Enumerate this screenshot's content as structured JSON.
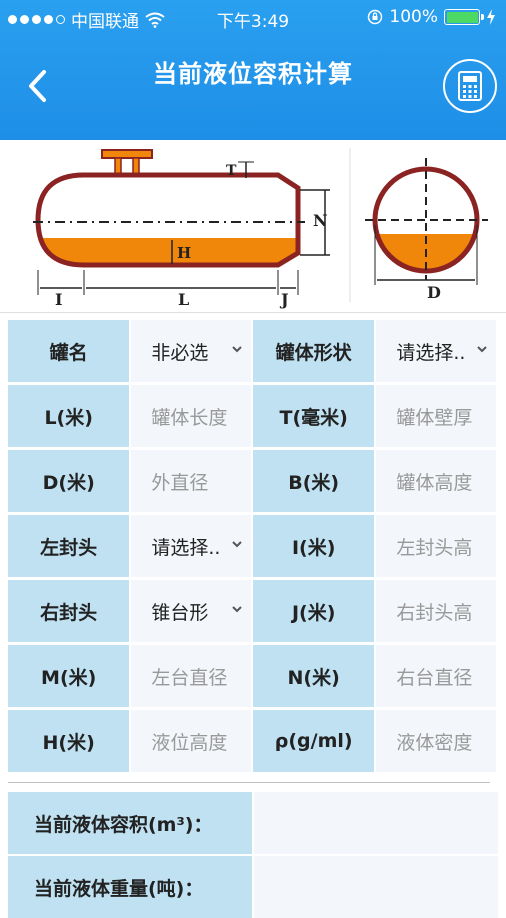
{
  "status": {
    "carrier": "中国联通",
    "time": "下午3:49",
    "battery": "100%"
  },
  "nav": {
    "title": "当前液位容积计算",
    "back_icon": "chevron-left-icon",
    "calc_icon": "calculator-icon"
  },
  "diagram": {
    "labels": {
      "T": "T",
      "N": "N",
      "H": "H",
      "I": "I",
      "L": "L",
      "J": "J",
      "D": "D"
    },
    "colors": {
      "tank": "#8b2323",
      "liquid": "#f0870a"
    }
  },
  "form": {
    "rows": [
      {
        "label1": "罐名",
        "value1": "非必选",
        "select1": true,
        "label2": "罐体形状",
        "value2": "请选择..",
        "select2": true
      },
      {
        "label1": "L(米)",
        "value1": "罐体长度",
        "label2": "T(毫米)",
        "value2": "罐体壁厚"
      },
      {
        "label1": "D(米)",
        "value1": "外直径",
        "label2": "B(米)",
        "value2": "罐体高度"
      },
      {
        "label1": "左封头",
        "value1": "请选择..",
        "select1": true,
        "label2": "I(米)",
        "value2": "左封头高"
      },
      {
        "label1": "右封头",
        "value1": "锥台形",
        "select1": true,
        "label2": "J(米)",
        "value2": "右封头高"
      },
      {
        "label1": "M(米)",
        "value1": "左台直径",
        "label2": "N(米)",
        "value2": "右台直径"
      },
      {
        "label1": "H(米)",
        "value1": "液位高度",
        "label2": "ρ(g/ml)",
        "value2": "液体密度"
      }
    ]
  },
  "results": {
    "volume_label": "当前液体容积(m³)：",
    "weight_label": "当前液体重量(吨)："
  }
}
